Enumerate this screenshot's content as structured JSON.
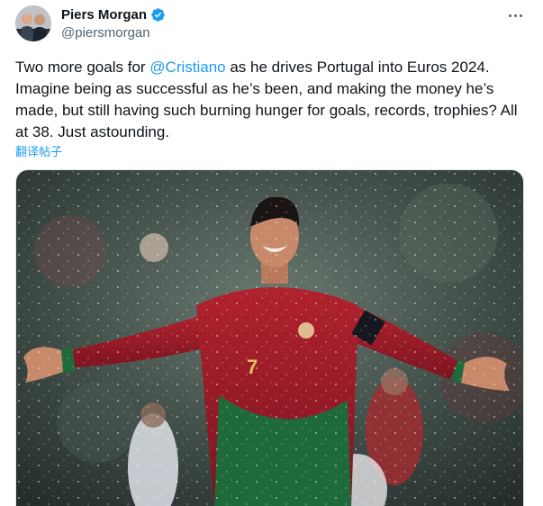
{
  "author": {
    "display_name": "Piers Morgan",
    "handle": "@piersmorgan",
    "avatar_icon": "avatar-photo",
    "verified_icon": "verified-badge-icon",
    "verified_color": "#1d9bf0"
  },
  "tweet": {
    "text_before": "Two more goals for ",
    "mention": "@Cristiano",
    "text_after": " as he drives Portugal into Euros 2024. Imagine being as successful as he’s been, and making the money he’s made, but still having such burning hunger for goals, records, trophies? All at 38. Just astounding.",
    "translate_label": "翻译帖子"
  },
  "media": {
    "kind": "photo",
    "jersey_number": "7"
  },
  "colors": {
    "link": "#1d9bf0",
    "text": "#0f1419",
    "secondary": "#536471"
  }
}
